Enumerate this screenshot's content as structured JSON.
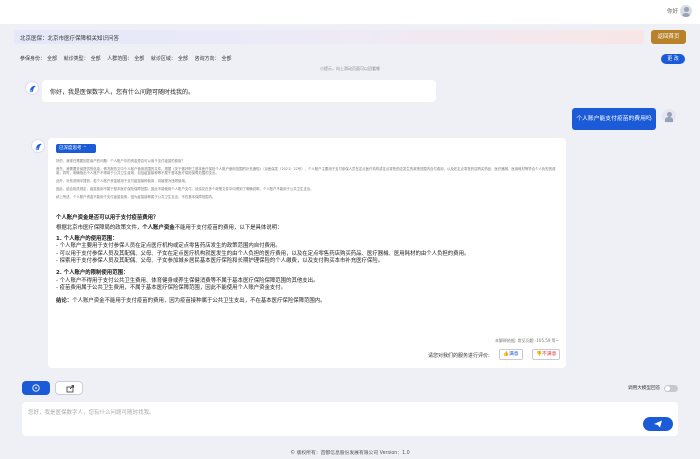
{
  "header": {
    "greeting": "你好"
  },
  "title_bar": {
    "title": "北京医保：北京市医疗保障相关知识问答",
    "back_button": "返回首页"
  },
  "filters": {
    "items": [
      {
        "label": "参保身份：",
        "value": "全部"
      },
      {
        "label": "就诊类型：",
        "value": "全部"
      },
      {
        "label": "人群范围：",
        "value": "全部"
      },
      {
        "label": "就诊区域：",
        "value": "全部"
      },
      {
        "label": "咨询方向：",
        "value": "全部"
      }
    ],
    "change_button": "更 改",
    "hint": "小提示，向上滑动页面可以回看哪"
  },
  "chat": {
    "greeting": "你好，我是医保数字人，您有什么问题可随时找我的。",
    "user_question": "个人账户能支付疫苗的费用吗",
    "think_toggle": "已深度思考",
    "thinking": [
      "好的，我现在需要回答用户的问题：个人账户中的资金是否可以用于支付疫苗的费用？",
      "首先，我需要查阅提供的信息。情况报告文中个人账户使用范围的文件。根据《关于做好职工基本医疗保险个人账户使用范围的补充通知》（京医保发〔2021〕22号），个人账户主要用于支付参保人员在定点医疗机构或定点零售药店发生的政策范围内自付费用，以及在定点零售药店购买药品、医疗器械、医用耗材等符合个人负担的费用。同时，明确指出个人账户不得用于公共卫生费用，包括疫苗接种等不属于基本医疗保险保障范围的支出。",
      "此外，补充说明中提到，若个人账户资金被用于支付疫苗接种费用，将被视为违规使用。",
      "因此，结合相关规定，疫苗费用不属于基本医疗保险保障范围，因此不能使用个人账户支付。该结论在多个政策文件中均得到了明确说明，个人账户不能用于公共卫生支出。",
      "综上所述，个人账户资金不能用于支付疫苗费用，因为疫苗接种属于公共卫生支出，不在基本保障范围内。"
    ],
    "answer_heading": "个人账户资金是否可以用于支付疫苗费用？",
    "answer_intro_prefix": "根据北京市医疗保障局的政策文件，",
    "answer_intro_bold": "个人账户资金",
    "answer_intro_suffix": "不能用于支付疫苗的费用，以下是具体说明：",
    "section1_title": "1. 个人账户的使用范围：",
    "section1_items": [
      "- 个人账户主要用于支付参保人员在定点医疗机构或定点零售药店发生的政策范围内自付费用。",
      "- 可以用于支付参保人员及其配偶、父母、子女在定点医疗机构就医发生的由个人负担的医疗费用，以及在定点零售药店购买药品、医疗器械、医用耗材的由个人负担的费用。",
      "- 探索用于支付参保人员及其配偶、父母、子女参加城乡居民基本医疗保险和长期护理保险的个人缴费，以及支付购买本市补充医疗保险。"
    ],
    "section2_title": "2. 个人账户的限制使用范围：",
    "section2_items": [
      "- 个人账户不得用于支付公共卫生费用、体育健身或养生保健消费等不属于基本医疗保险保障范围的其他支出。",
      "- 疫苗费用属于公共卫生费用，不属于基本医疗保险保障范围，因此不能使用个人账户资金支付。"
    ],
    "conclusion_label": "结论：",
    "conclusion_text": "个人账户资金不能用于支付疫苗的费用，因为疫苗接种属于公共卫生支出，不在基本医疗保险保障范围内。",
    "stats": "本解释依据: 常见问题 -105.59 等~",
    "evaluate_prompt": "请您对我们的服务进行评价:",
    "satisfied": "满意",
    "unsatisfied": "不满意"
  },
  "composer": {
    "toggle_label": "调用大模型回答",
    "placeholder": "您好，我是医保数字人，您有什么问题可随时找我。"
  },
  "footer": "© 版权所有：首都信息股份发展有限公司 Version：1.0",
  "colors": {
    "primary": "#1c5bd8",
    "back_button": "#b8822a"
  }
}
